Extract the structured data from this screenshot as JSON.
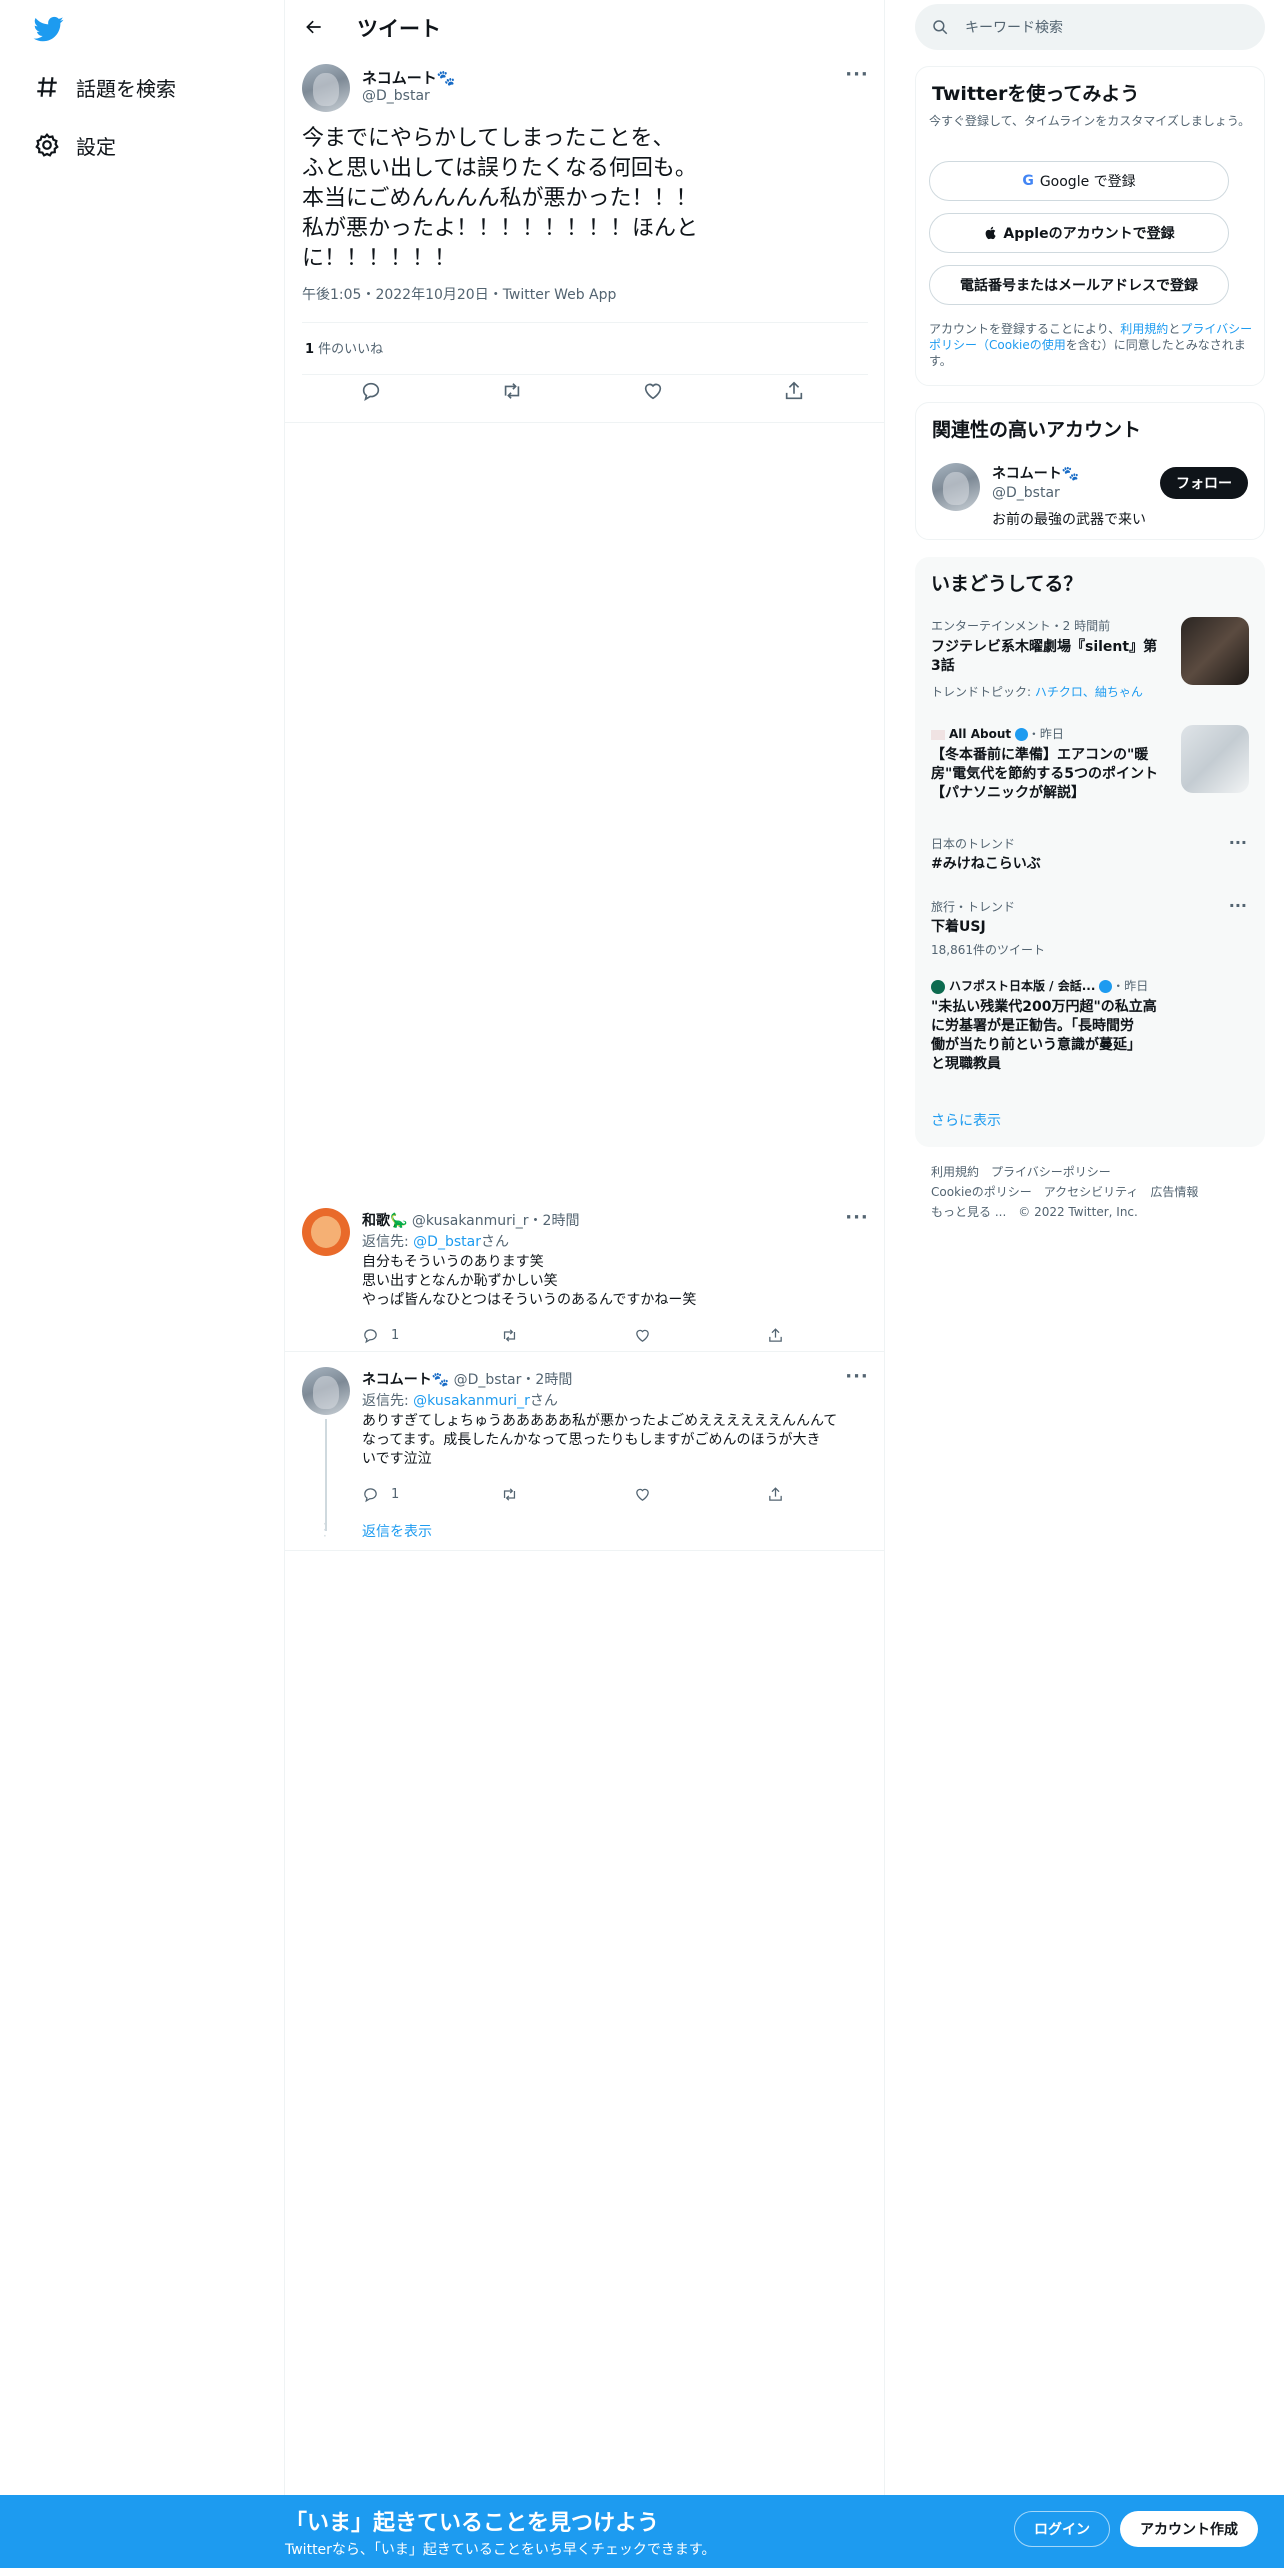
{
  "nav": {
    "items": [
      {
        "label": "話題を検索",
        "icon": "hashtag-icon"
      },
      {
        "label": "設定",
        "icon": "gear-icon"
      }
    ]
  },
  "header": {
    "title": "ツイート"
  },
  "tweet": {
    "name": "ネコムート🐾",
    "handle": "@D_bstar",
    "text": "今までにやらかしてしまったことを、\nふと思い出しては誤りたくなる何回も。\n本当にごめんんんん私が悪かった！！！\n私が悪かったよ！！！！！！！！ほんと\nに！！！！！！",
    "meta": "午後1:05・2022年10月20日・Twitter Web App",
    "likes_count": "1",
    "likes_label": " 件のいいね"
  },
  "replies": [
    {
      "name": "和歌🦕",
      "handle": "@kusakanmuri_r",
      "time": "・2時間",
      "to_prefix": "返信先: ",
      "to_handle": "@D_bstar",
      "to_suffix": "さん",
      "text": "自分もそういうのあります笑\n思い出すとなんか恥ずかしい笑\nやっぱ皆んなひとつはそういうのあるんですかねー笑",
      "reply_count": "1"
    },
    {
      "name": "ネコムート🐾",
      "handle": "@D_bstar",
      "time": "・2時間",
      "to_prefix": "返信先: ",
      "to_handle": "@kusakanmuri_r",
      "to_suffix": "さん",
      "text": "ありすぎてしょちゅうあああああ私が悪かったよごめええええええんんんて\nなってます。成長したんかなって思ったりもしますがごめんのほうが大き\nいです泣泣",
      "reply_count": "1"
    }
  ],
  "show_replies": "返信を表示",
  "right": {
    "search_placeholder": "キーワード検索",
    "signup_card": {
      "title": "Twitterを使ってみよう",
      "subtitle": "今すぐ登録して、タイムラインをカスタマイズしましょう。",
      "google": "Google で登録",
      "apple": "Appleのアカウントで登録",
      "phone": "電話番号またはメールアドレスで登録",
      "terms_a": "アカウントを登録することにより、",
      "terms_link1": "利用規約",
      "terms_b": "と",
      "terms_link2": "プライバシーポリシー（Cookieの使用",
      "terms_c": "を含む）に同意したとみなされます。"
    },
    "related": {
      "title": "関連性の高いアカウント",
      "name": "ネコムート🐾",
      "handle": "@D_bstar",
      "bio": "お前の最強の武器で来い",
      "follow": "フォロー"
    },
    "trends": {
      "title": "いまどうしてる？",
      "items": [
        {
          "category": "エンターテインメント・2 時間前",
          "title": "フジテレビ系木曜劇場『silent』第\n3話",
          "topic_prefix": "トレンドトピック: ",
          "topic": "ハチクロ、紬ちゃん"
        },
        {
          "category": "All About",
          "time": "・昨日",
          "title": "【冬本番前に準備】エアコンの\"暖\n房\"電気代を節約する5つのポイント\n【パナソニックが解説】"
        },
        {
          "category": "日本のトレンド",
          "title": "#みけねこらいぶ"
        },
        {
          "category": "旅行・トレンド",
          "title": "下着USJ",
          "count": "18,861件のツイート"
        },
        {
          "category": "ハフポスト日本版 / 会話...",
          "time": "・昨日",
          "title": "\"未払い残業代200万円超\"の私立高\nに労基署が是正勧告。「長時間労\n働が当たり前という意識が蔓延」\nと現職教員"
        }
      ],
      "show_more": "さらに表示"
    },
    "footer": [
      "利用規約",
      "プライバシーポリシー",
      "Cookieのポリシー",
      "アクセシビリティ",
      "広告情報",
      "もっと見る ...",
      "© 2022 Twitter, Inc."
    ]
  },
  "bottom": {
    "title": "「いま」起きていることを見つけよう",
    "subtitle": "Twitterなら、「いま」起きていることをいち早くチェックできます。",
    "login": "ログイン",
    "signup": "アカウント作成"
  },
  "colors": {
    "accent": "#1d9bf0",
    "text": "#0f1419",
    "muted": "#536471",
    "border": "#eff3f4"
  }
}
